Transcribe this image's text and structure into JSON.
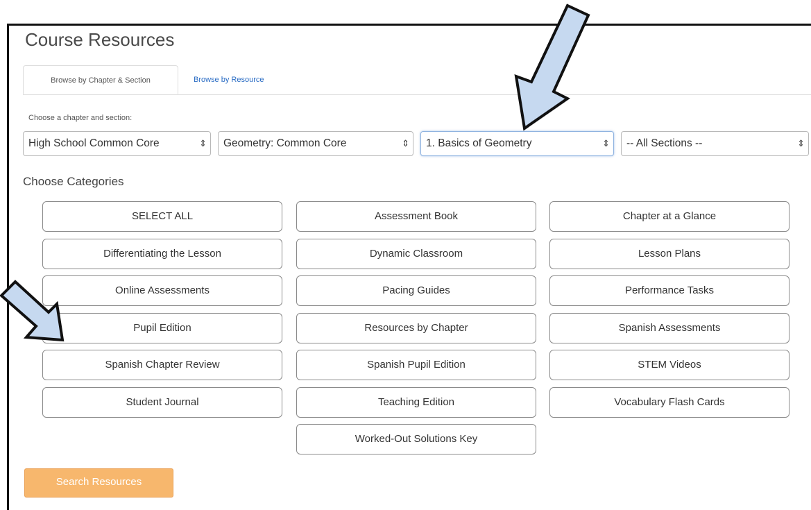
{
  "page": {
    "title": "Course Resources"
  },
  "tabs": [
    {
      "label": "Browse by Chapter & Section"
    },
    {
      "label": "Browse by Resource"
    }
  ],
  "chooser": {
    "label": "Choose a chapter and section:",
    "selects": [
      {
        "value": "High School Common Core"
      },
      {
        "value": "Geometry: Common Core"
      },
      {
        "value": "1. Basics of Geometry"
      },
      {
        "value": "-- All Sections --"
      }
    ]
  },
  "categories": {
    "label": "Choose Categories",
    "buttons": [
      "SELECT ALL",
      "Assessment Book",
      "Chapter at a Glance",
      "Differentiating the Lesson",
      "Dynamic Classroom",
      "Lesson Plans",
      "Online Assessments",
      "Pacing Guides",
      "Performance Tasks",
      "Pupil Edition",
      "Resources by Chapter",
      "Spanish Assessments",
      "Spanish Chapter Review",
      "Spanish Pupil Edition",
      "STEM Videos",
      "Student Journal",
      "Teaching Edition",
      "Vocabulary Flash Cards",
      "Worked-Out Solutions Key"
    ]
  },
  "search": {
    "label": "Search Resources"
  },
  "colors": {
    "accent": "#f7b76d",
    "link": "#2a6cc4",
    "annotation_arrow": "#c6d9f0"
  }
}
